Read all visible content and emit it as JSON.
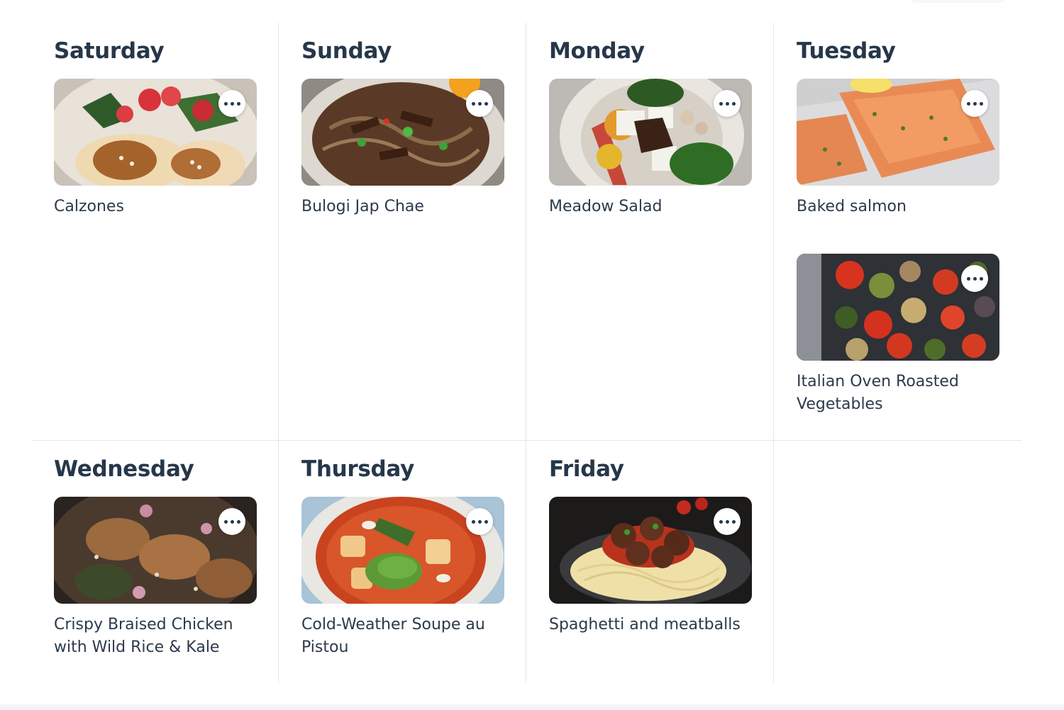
{
  "days": [
    {
      "name": "Saturday",
      "meals": [
        {
          "name": "Calzones",
          "image": "calzones-photo",
          "menu_icon": "more-options-icon"
        }
      ]
    },
    {
      "name": "Sunday",
      "meals": [
        {
          "name": "Bulogi Jap Chae",
          "image": "jap-chae-photo",
          "menu_icon": "more-options-icon"
        }
      ]
    },
    {
      "name": "Monday",
      "meals": [
        {
          "name": "Meadow Salad",
          "image": "salad-photo",
          "menu_icon": "more-options-icon"
        }
      ]
    },
    {
      "name": "Tuesday",
      "meals": [
        {
          "name": "Baked salmon",
          "image": "salmon-photo",
          "menu_icon": "more-options-icon"
        },
        {
          "name": "Italian Oven Roasted Vegetables",
          "image": "roasted-vegetables-photo",
          "menu_icon": "more-options-icon"
        }
      ]
    },
    {
      "name": "Wednesday",
      "meals": [
        {
          "name": "Crispy Braised Chicken with Wild Rice & Kale",
          "image": "braised-chicken-photo",
          "menu_icon": "more-options-icon"
        }
      ]
    },
    {
      "name": "Thursday",
      "meals": [
        {
          "name": "Cold-Weather Soupe au Pistou",
          "image": "soupe-pistou-photo",
          "menu_icon": "more-options-icon"
        }
      ]
    },
    {
      "name": "Friday",
      "meals": [
        {
          "name": "Spaghetti and meatballs",
          "image": "spaghetti-meatballs-photo",
          "menu_icon": "more-options-icon"
        }
      ]
    }
  ],
  "colors": {
    "text": "#26374a",
    "divider": "#e3e6ea",
    "background": "#ffffff"
  }
}
